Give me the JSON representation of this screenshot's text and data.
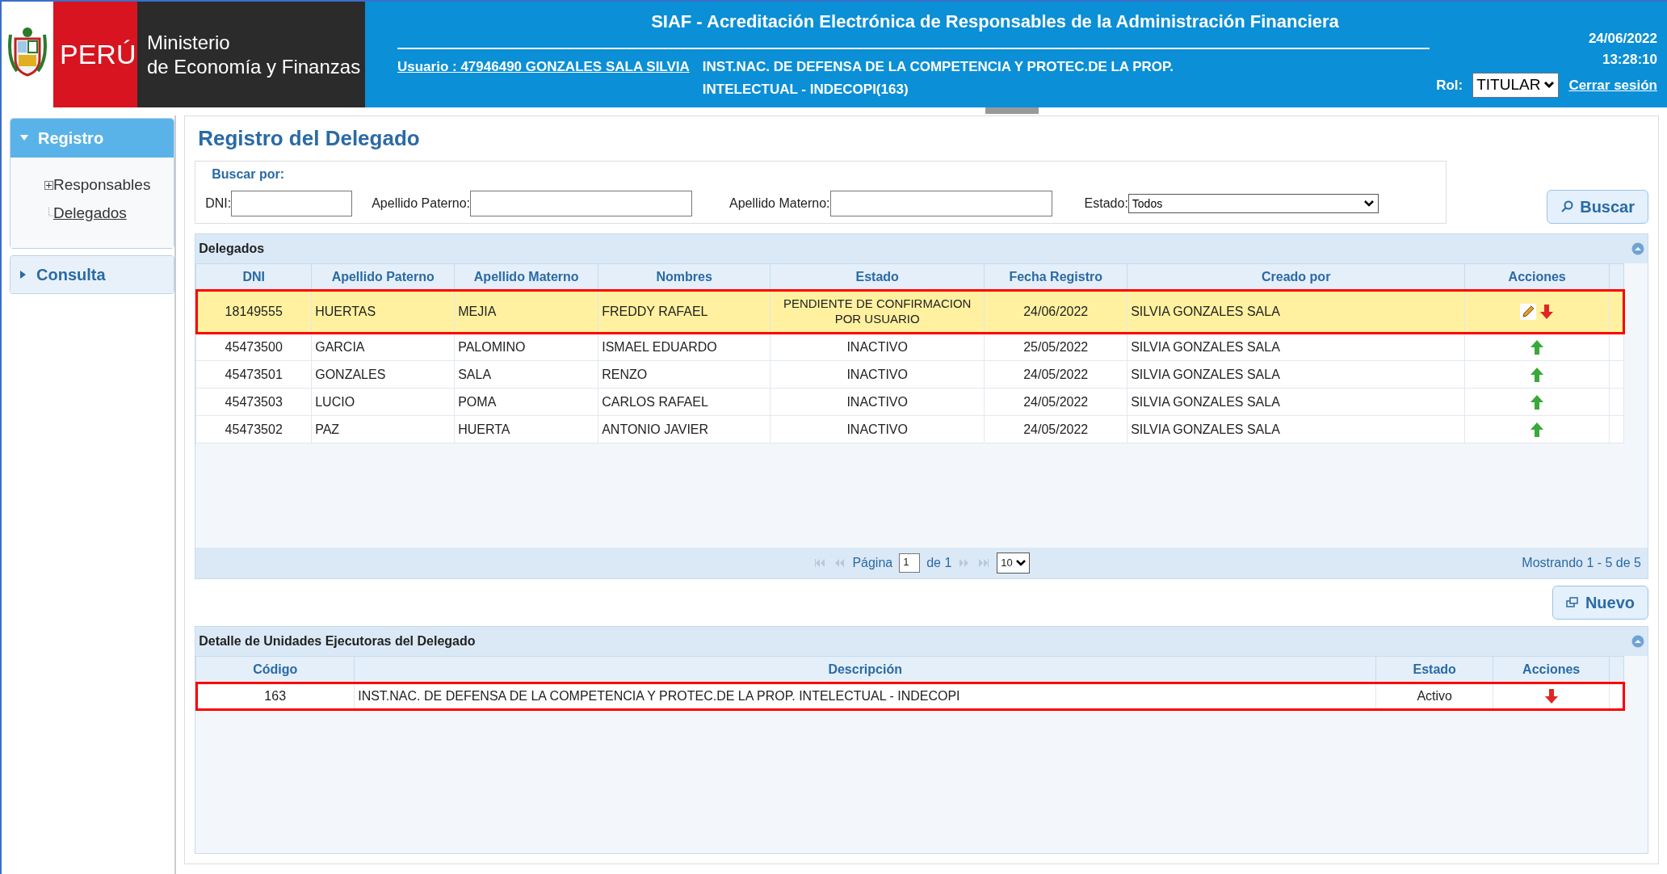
{
  "header": {
    "country": "PERÚ",
    "ministry_line1": "Ministerio",
    "ministry_line2": "de Economía y Finanzas",
    "title": "SIAF - Acreditación Electrónica de Responsables de la Administración Financiera",
    "user_link": "Usuario : 47946490 GONZALES SALA SILVIA",
    "institution": "INST.NAC. DE DEFENSA DE LA COMPETENCIA Y PROTEC.DE LA PROP. INTELECTUAL - INDECOPI(163)",
    "date": "24/06/2022",
    "time": "13:28:10",
    "role_label": "Rol:",
    "role_value": "TITULAR",
    "logout": "Cerrar sesión"
  },
  "sidebar": {
    "sections": [
      {
        "label": "Registro",
        "expanded": true,
        "items": [
          {
            "label": "Responsables",
            "expandable": true,
            "selected": false
          },
          {
            "label": "Delegados",
            "expandable": false,
            "selected": true
          }
        ]
      },
      {
        "label": "Consulta",
        "expanded": false
      }
    ]
  },
  "page_title": "Registro del Delegado",
  "search": {
    "legend": "Buscar por:",
    "fields": [
      {
        "kind": "text",
        "label": "DNI:"
      },
      {
        "kind": "text",
        "label": "Apellido Paterno:"
      },
      {
        "kind": "text",
        "label": "Apellido Materno:"
      },
      {
        "kind": "select",
        "label": "Estado:",
        "value": "Todos"
      }
    ],
    "button": "Buscar"
  },
  "delegados": {
    "title": "Delegados",
    "columns": [
      "DNI",
      "Apellido Paterno",
      "Apellido Materno",
      "Nombres",
      "Estado",
      "Fecha Registro",
      "Creado por",
      "Acciones"
    ],
    "rows": [
      {
        "cells": [
          "18149555",
          "HUERTAS",
          "MEJIA",
          "FREDDY RAFAEL",
          "PENDIENTE DE CONFIRMACION POR USUARIO",
          "24/06/2022",
          "SILVIA GONZALES SALA"
        ],
        "actions": [
          {
            "kind": "edit"
          },
          {
            "kind": "down"
          }
        ],
        "selected": true,
        "highlighted": true
      },
      {
        "cells": [
          "45473500",
          "GARCIA",
          "PALOMINO",
          "ISMAEL EDUARDO",
          "INACTIVO",
          "25/05/2022",
          "SILVIA GONZALES SALA"
        ],
        "actions": [
          {
            "kind": "up"
          }
        ],
        "selected": false,
        "highlighted": false
      },
      {
        "cells": [
          "45473501",
          "GONZALES",
          "SALA",
          "RENZO",
          "INACTIVO",
          "24/05/2022",
          "SILVIA GONZALES SALA"
        ],
        "actions": [
          {
            "kind": "up"
          }
        ],
        "selected": false,
        "highlighted": false
      },
      {
        "cells": [
          "45473503",
          "LUCIO",
          "POMA",
          "CARLOS RAFAEL",
          "INACTIVO",
          "24/05/2022",
          "SILVIA GONZALES SALA"
        ],
        "actions": [
          {
            "kind": "up"
          }
        ],
        "selected": false,
        "highlighted": false
      },
      {
        "cells": [
          "45473502",
          "PAZ",
          "HUERTA",
          "ANTONIO JAVIER",
          "INACTIVO",
          "24/05/2022",
          "SILVIA GONZALES SALA"
        ],
        "actions": [
          {
            "kind": "up"
          }
        ],
        "selected": false,
        "highlighted": false
      }
    ],
    "pager": {
      "page_label": "Página",
      "page": "1",
      "of_label": "de 1",
      "page_size": "10",
      "summary": "Mostrando 1 - 5 de 5"
    }
  },
  "new_button": "Nuevo",
  "detalle": {
    "title": "Detalle de Unidades Ejecutoras del Delegado",
    "columns": [
      "Código",
      "Descripción",
      "Estado",
      "Acciones"
    ],
    "rows": [
      {
        "cells": [
          "163",
          "INST.NAC. DE DEFENSA DE LA COMPETENCIA Y PROTEC.DE LA PROP. INTELECTUAL - INDECOPI",
          "Activo"
        ],
        "actions": [
          {
            "kind": "down"
          }
        ],
        "selected": false,
        "highlighted": true
      }
    ]
  }
}
